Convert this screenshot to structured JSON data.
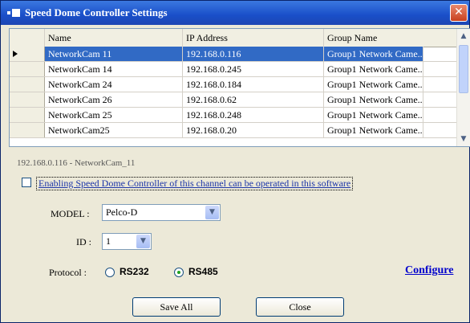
{
  "window": {
    "title": "Speed Dome Controller Settings",
    "close_glyph": "✕"
  },
  "table": {
    "headers": [
      "Name",
      "IP Address",
      "Group Name"
    ],
    "rows": [
      [
        "NetworkCam 11",
        "192.168.0.116",
        "Group1 Network Came..."
      ],
      [
        "NetworkCam 14",
        "192.168.0.245",
        "Group1 Network Came..."
      ],
      [
        "NetworkCam 24",
        "192.168.0.184",
        "Group1 Network Came..."
      ],
      [
        "NetworkCam 26",
        "192.168.0.62",
        "Group1 Network Came..."
      ],
      [
        "NetworkCam 25",
        "192.168.0.248",
        "Group1 Network Came..."
      ],
      [
        "NetworkCam25",
        "192.168.0.20",
        "Group1 Network Came..."
      ]
    ],
    "selected_row": 0
  },
  "channel_label": "192.168.0.116 - NetworkCam_11",
  "enable": {
    "label": "Enabling Speed Dome Controller of this channel can be operated in this software",
    "checked": false
  },
  "model": {
    "label": "MODEL :",
    "value": "Pelco-D"
  },
  "id": {
    "label": "ID :",
    "value": "1"
  },
  "protocol": {
    "label": "Protocol :",
    "options": [
      "RS232",
      "RS485"
    ],
    "selected": "RS485"
  },
  "configure_link": "Configure",
  "buttons": {
    "save_all": "Save All",
    "close": "Close"
  },
  "icons": {
    "scroll_up": "▲",
    "scroll_down": "▼",
    "dropdown": "▼"
  },
  "colors": {
    "titlebar": "#1a4fc9",
    "selection": "#316ac5",
    "link": "#0000cc"
  }
}
